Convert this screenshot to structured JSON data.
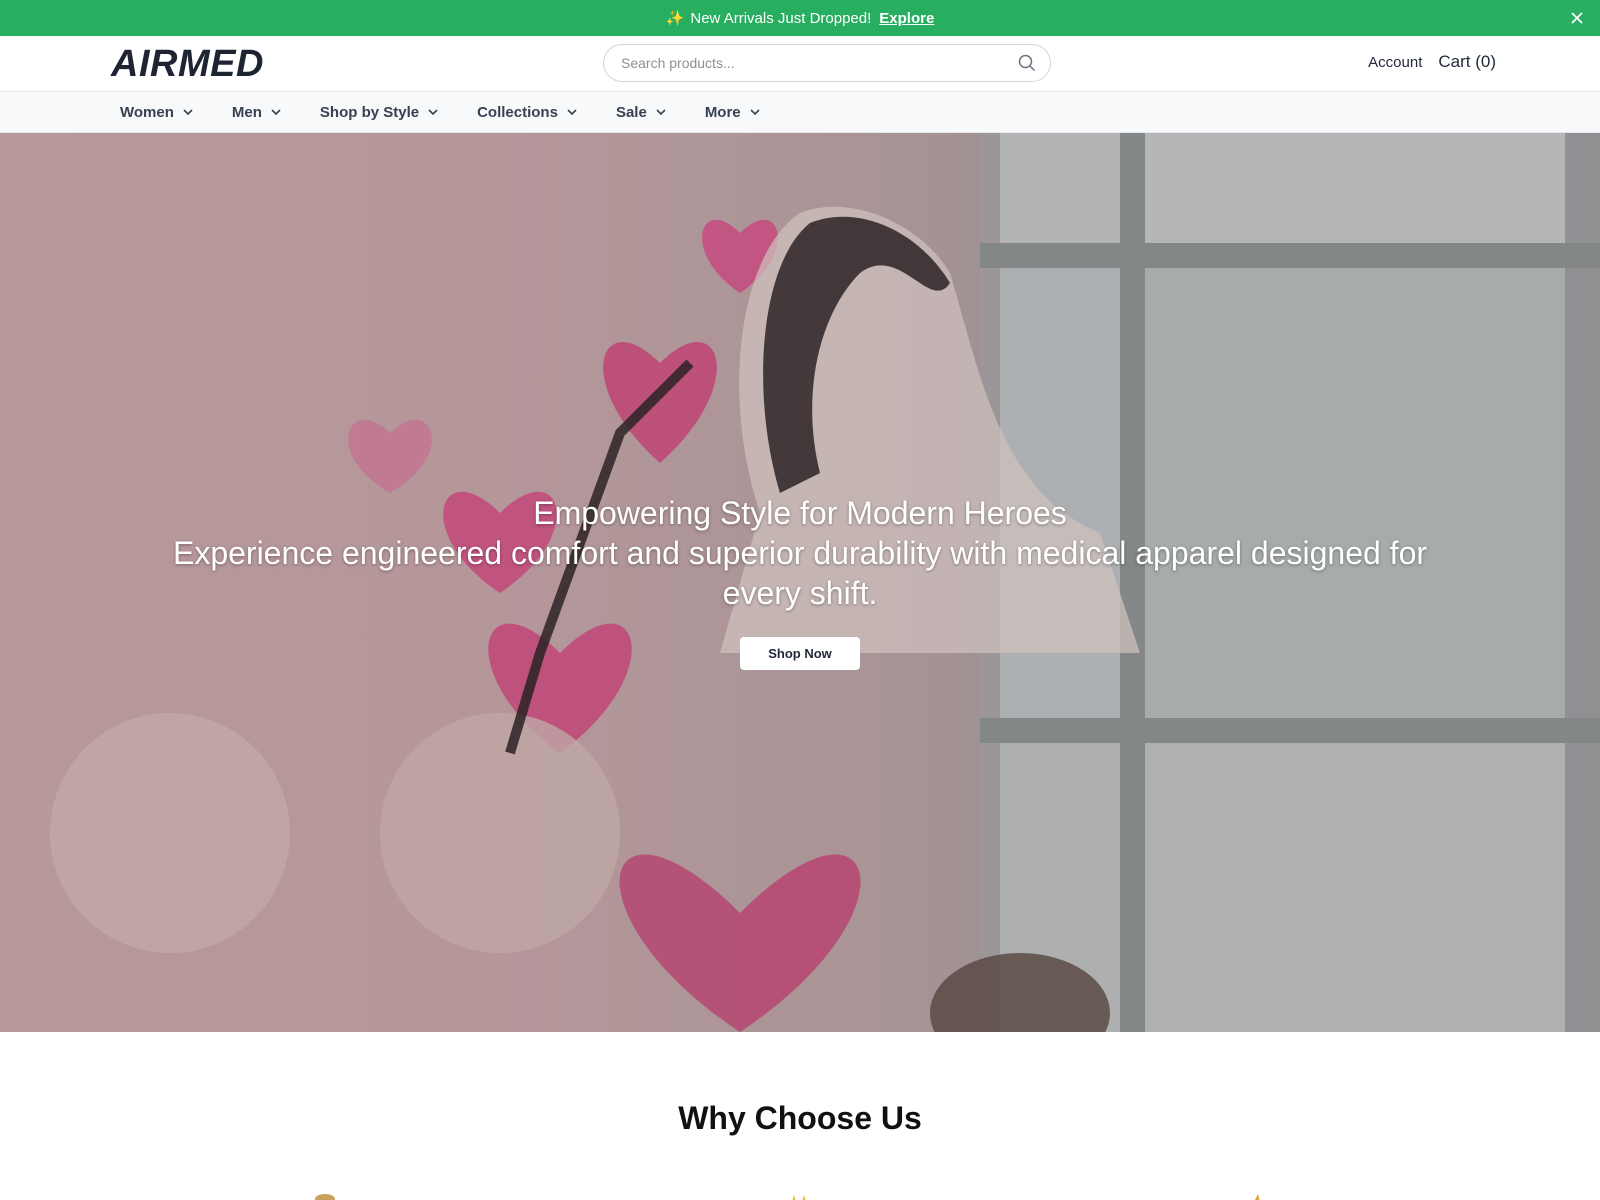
{
  "announcement": {
    "text": "New Arrivals Just Dropped!",
    "link": "Explore",
    "close_icon": "close-icon",
    "spark_icon": "sparkles-icon",
    "spark_glyph": "✨"
  },
  "header": {
    "logo": "AIRMED",
    "search_placeholder": "Search products...",
    "search_icon": "search-icon",
    "account": "Account",
    "cart": "Cart (0)"
  },
  "nav": {
    "items": [
      {
        "label": "Women"
      },
      {
        "label": "Men"
      },
      {
        "label": "Shop by Style"
      },
      {
        "label": "Collections"
      },
      {
        "label": "Sale"
      },
      {
        "label": "More"
      }
    ]
  },
  "hero": {
    "title": "Empowering Style for Modern Heroes",
    "subtitle": "Experience engineered comfort and superior durability with medical apparel designed for every shift.",
    "cta": "Shop Now"
  },
  "why": {
    "title": "Why Choose Us"
  },
  "colors": {
    "announcement_bg": "#27ae60",
    "logo": "#1f2433",
    "nav_bg": "#f8f9fa"
  }
}
